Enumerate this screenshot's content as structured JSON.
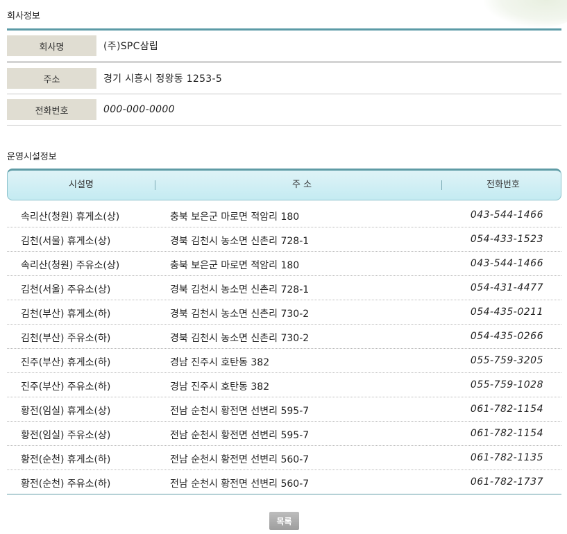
{
  "company_section": {
    "title": "회사정보",
    "rows": [
      {
        "label": "회사명",
        "value": "(주)SPC삼립"
      },
      {
        "label": "주소",
        "value": "경기 시흥시 정왕동 1253-5"
      },
      {
        "label": "전화번호",
        "value": "000-000-0000"
      }
    ]
  },
  "facility_section": {
    "title": "운영시설정보",
    "headers": {
      "name": "시설명",
      "address": "주 소",
      "phone": "전화번호"
    },
    "rows": [
      {
        "name": "속리산(청원) 휴게소(상)",
        "address": "충북 보은군 마로면 적암리 180",
        "phone": "043-544-1466"
      },
      {
        "name": "김천(서울) 휴게소(상)",
        "address": "경북 김천시 농소면 신촌리 728-1",
        "phone": "054-433-1523"
      },
      {
        "name": "속리산(청원) 주유소(상)",
        "address": "충북 보은군 마로면 적암리 180",
        "phone": "043-544-1466"
      },
      {
        "name": "김천(서울) 주유소(상)",
        "address": "경북 김천시 농소면 신촌리 728-1",
        "phone": "054-431-4477"
      },
      {
        "name": "김천(부산) 휴게소(하)",
        "address": "경북 김천시 농소면 신촌리 730-2",
        "phone": "054-435-0211"
      },
      {
        "name": "김천(부산) 주유소(하)",
        "address": "경북 김천시 농소면 신촌리 730-2",
        "phone": "054-435-0266"
      },
      {
        "name": "진주(부산) 휴게소(하)",
        "address": "경남 진주시 호탄동 382",
        "phone": "055-759-3205"
      },
      {
        "name": "진주(부산) 주유소(하)",
        "address": "경남 진주시 호탄동 382",
        "phone": "055-759-1028"
      },
      {
        "name": "황전(임실) 휴게소(상)",
        "address": "전남 순천시 황전면 선변리 595-7",
        "phone": "061-782-1154"
      },
      {
        "name": "황전(임실) 주유소(상)",
        "address": "전남 순천시 황전면 선변리 595-7",
        "phone": "061-782-1154"
      },
      {
        "name": "황전(순천) 휴게소(하)",
        "address": "전남 순천시 황전면 선변리 560-7",
        "phone": "061-782-1135"
      },
      {
        "name": "황전(순천) 주유소(하)",
        "address": "전남 순천시 황전면 선변리 560-7",
        "phone": "061-782-1737"
      }
    ]
  },
  "buttons": {
    "list_label": "목록"
  },
  "colors": {
    "accent": "#5e9ba5",
    "label_bg": "#e0ddd2",
    "header_bg": "#c4ebf2"
  }
}
